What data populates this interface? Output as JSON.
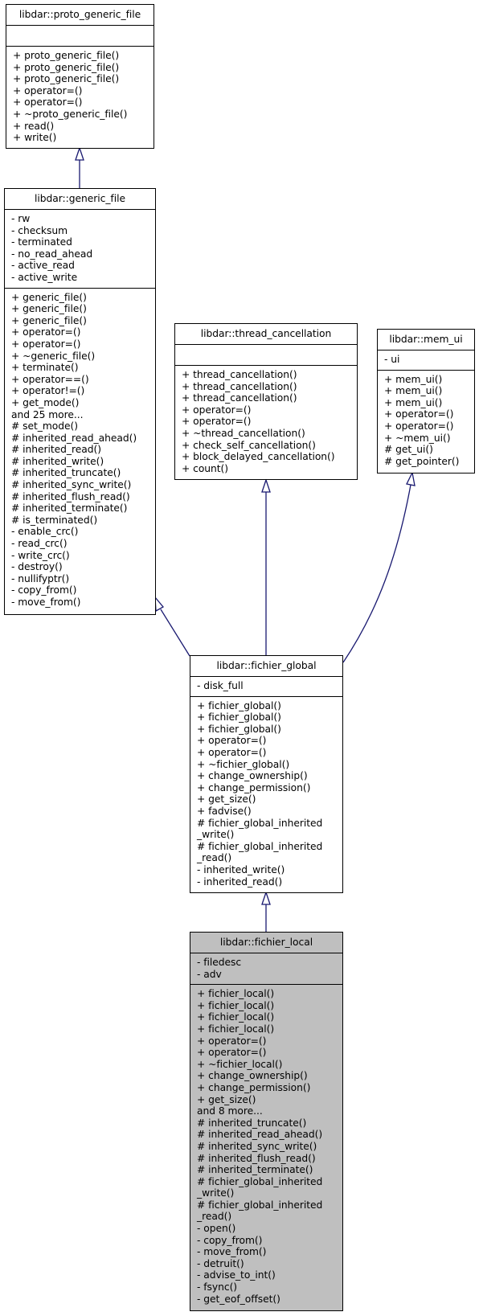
{
  "diagram": {
    "kind": "class inheritance diagram",
    "classes": [
      {
        "id": "proto_generic_file",
        "name": "libdar::proto_generic_file",
        "attributes": [],
        "operations": [
          "+ proto_generic_file()",
          "+ proto_generic_file()",
          "+ proto_generic_file()",
          "+ operator=()",
          "+ operator=()",
          "+ ~proto_generic_file()",
          "+ read()",
          "+ write()"
        ]
      },
      {
        "id": "generic_file",
        "name": "libdar::generic_file",
        "attributes": [
          "- rw",
          "- checksum",
          "- terminated",
          "- no_read_ahead",
          "- active_read",
          "- active_write"
        ],
        "operations": [
          "+ generic_file()",
          "+ generic_file()",
          "+ generic_file()",
          "+ operator=()",
          "+ operator=()",
          "+ ~generic_file()",
          "+ terminate()",
          "+ operator==()",
          "+ operator!=()",
          "+ get_mode()",
          "and 25 more...",
          "# set_mode()",
          "# inherited_read_ahead()",
          "# inherited_read()",
          "# inherited_write()",
          "# inherited_truncate()",
          "# inherited_sync_write()",
          "# inherited_flush_read()",
          "# inherited_terminate()",
          "# is_terminated()",
          "- enable_crc()",
          "- read_crc()",
          "- write_crc()",
          "- destroy()",
          "- nullifyptr()",
          "- copy_from()",
          "- move_from()"
        ]
      },
      {
        "id": "thread_cancellation",
        "name": "libdar::thread_cancellation",
        "attributes": [],
        "operations": [
          "+ thread_cancellation()",
          "+ thread_cancellation()",
          "+ thread_cancellation()",
          "+ operator=()",
          "+ operator=()",
          "+ ~thread_cancellation()",
          "+ check_self_cancellation()",
          "+ block_delayed_cancellation()",
          "+ count()"
        ]
      },
      {
        "id": "mem_ui",
        "name": "libdar::mem_ui",
        "attributes": [
          "- ui"
        ],
        "operations": [
          "+ mem_ui()",
          "+ mem_ui()",
          "+ mem_ui()",
          "+ operator=()",
          "+ operator=()",
          "+ ~mem_ui()",
          "# get_ui()",
          "# get_pointer()"
        ]
      },
      {
        "id": "fichier_global",
        "name": "libdar::fichier_global",
        "attributes": [
          "- disk_full"
        ],
        "operations": [
          "+ fichier_global()",
          "+ fichier_global()",
          "+ fichier_global()",
          "+ operator=()",
          "+ operator=()",
          "+ ~fichier_global()",
          "+ change_ownership()",
          "+ change_permission()",
          "+ get_size()",
          "+ fadvise()",
          "# fichier_global_inherited",
          "_write()",
          "# fichier_global_inherited",
          "_read()",
          "- inherited_write()",
          "- inherited_read()"
        ]
      },
      {
        "id": "fichier_local",
        "name": "libdar::fichier_local",
        "highlighted": true,
        "attributes": [
          "- filedesc",
          "- adv"
        ],
        "operations": [
          "+ fichier_local()",
          "+ fichier_local()",
          "+ fichier_local()",
          "+ fichier_local()",
          "+ operator=()",
          "+ operator=()",
          "+ ~fichier_local()",
          "+ change_ownership()",
          "+ change_permission()",
          "+ get_size()",
          "and 8 more...",
          "# inherited_truncate()",
          "# inherited_read_ahead()",
          "# inherited_sync_write()",
          "# inherited_flush_read()",
          "# inherited_terminate()",
          "# fichier_global_inherited",
          "_write()",
          "# fichier_global_inherited",
          "_read()",
          "- open()",
          "- copy_from()",
          "- move_from()",
          "- detruit()",
          "- advise_to_int()",
          "- fsync()",
          "- get_eof_offset()"
        ]
      }
    ],
    "inheritance": [
      {
        "child": "generic_file",
        "parent": "proto_generic_file"
      },
      {
        "child": "fichier_global",
        "parent": "generic_file"
      },
      {
        "child": "fichier_global",
        "parent": "thread_cancellation"
      },
      {
        "child": "fichier_global",
        "parent": "mem_ui"
      },
      {
        "child": "fichier_local",
        "parent": "fichier_global"
      }
    ],
    "colors": {
      "edge": "#191970",
      "box_border": "#000000",
      "box_fill": "#ffffff",
      "focus_fill": "#bfbfbf"
    }
  }
}
